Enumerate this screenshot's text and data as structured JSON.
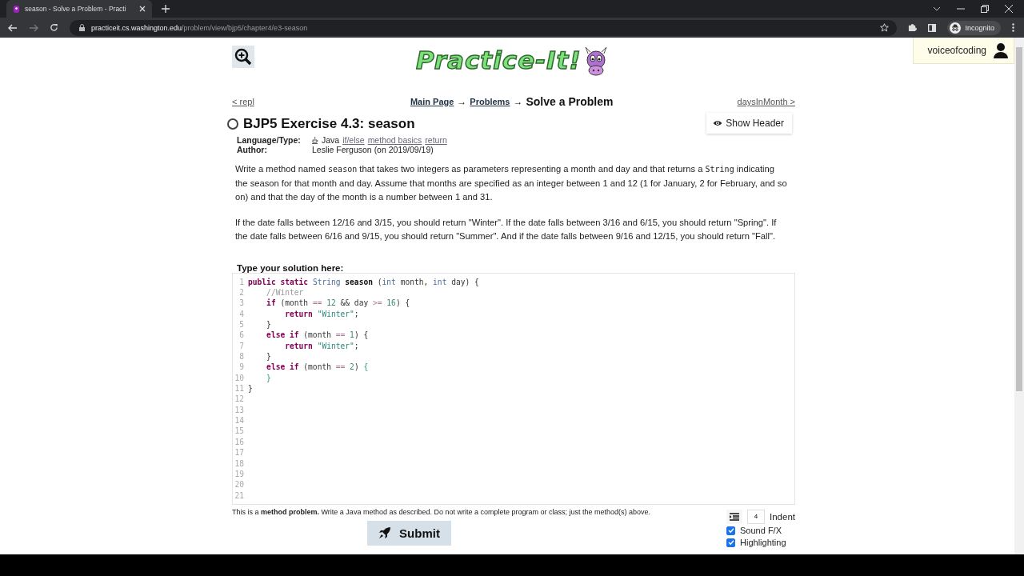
{
  "browser": {
    "tab_title": "season - Solve a Problem - Practi",
    "url_host": "practiceit.cs.washington.edu",
    "url_path": "/problem/view/bjp5/chapter4/e3-season",
    "profile": "Incognito"
  },
  "user": {
    "name": "voiceofcoding"
  },
  "logo": {
    "text": "Practice-It!"
  },
  "nav": {
    "prev": "< repl",
    "crumbs": [
      "Main Page",
      "Problems"
    ],
    "separators": [
      "→",
      "→"
    ],
    "current": "Solve a Problem",
    "next": "daysInMonth >"
  },
  "show_header_button": "Show Header",
  "problem": {
    "title": "BJP5 Exercise 4.3: season",
    "solved": false,
    "meta": [
      {
        "label": "Language/Type:",
        "kind": "type",
        "lang": "Java",
        "tags": [
          "if/else",
          "method basics",
          "return"
        ]
      },
      {
        "label": "Author:",
        "kind": "text",
        "value": "Leslie Ferguson (on 2019/09/19)"
      }
    ],
    "paragraphs": [
      [
        {
          "kind": "text",
          "text": "Write a method named "
        },
        {
          "kind": "code",
          "text": "season"
        },
        {
          "kind": "text",
          "text": " that takes two integers as parameters representing a month and day and that returns a "
        },
        {
          "kind": "code",
          "text": "String"
        },
        {
          "kind": "text",
          "text": " indicating the season for that month and day. Assume that months are specified as an integer between 1 and 12 (1 for January, 2 for February, and so on) and that the day of the month is a number between 1 and 31."
        }
      ],
      [
        {
          "kind": "text",
          "text": "If the date falls between 12/16 and 3/15, you should return \"Winter\". If the date falls between 3/16 and 6/15, you should return \"Spring\". If the date falls between 6/16 and 9/15, you should return \"Summer\". And if the date falls between 9/16 and 12/15, you should return \"Fall\"."
        }
      ]
    ]
  },
  "editor": {
    "label": "Type your solution here:",
    "lines": [
      {
        "number": "1",
        "tokens": [
          {
            "kind": "kw",
            "text": "public static "
          },
          {
            "kind": "type",
            "text": "String "
          },
          {
            "kind": "name",
            "text": "season"
          },
          {
            "kind": "plain",
            "text": " ("
          },
          {
            "kind": "type",
            "text": "int"
          },
          {
            "kind": "plain",
            "text": " month, "
          },
          {
            "kind": "type",
            "text": "int"
          },
          {
            "kind": "plain",
            "text": " day) {"
          }
        ]
      },
      {
        "number": "2",
        "tokens": [
          {
            "kind": "comment",
            "text": "    //Winter"
          }
        ]
      },
      {
        "number": "3",
        "tokens": [
          {
            "kind": "kw",
            "text": "    if"
          },
          {
            "kind": "plain",
            "text": " (month "
          },
          {
            "kind": "op",
            "text": "=="
          },
          {
            "kind": "num",
            "text": " 12"
          },
          {
            "kind": "plain",
            "text": " && day "
          },
          {
            "kind": "op",
            "text": ">="
          },
          {
            "kind": "num",
            "text": " 16"
          },
          {
            "kind": "plain",
            "text": ") {"
          }
        ]
      },
      {
        "number": "4",
        "tokens": [
          {
            "kind": "kw",
            "text": "        return "
          },
          {
            "kind": "str",
            "text": "\"Winter\""
          },
          {
            "kind": "plain",
            "text": ";"
          }
        ]
      },
      {
        "number": "5",
        "tokens": [
          {
            "kind": "plain",
            "text": "    }"
          }
        ]
      },
      {
        "number": "6",
        "tokens": [
          {
            "kind": "kw",
            "text": "    else if"
          },
          {
            "kind": "plain",
            "text": " (month "
          },
          {
            "kind": "op",
            "text": "=="
          },
          {
            "kind": "num",
            "text": " 1"
          },
          {
            "kind": "plain",
            "text": ") {"
          }
        ]
      },
      {
        "number": "7",
        "tokens": [
          {
            "kind": "kw",
            "text": "        return "
          },
          {
            "kind": "str",
            "text": "\"Winter\""
          },
          {
            "kind": "plain",
            "text": ";"
          }
        ]
      },
      {
        "number": "8",
        "tokens": [
          {
            "kind": "plain",
            "text": "    }"
          }
        ]
      },
      {
        "number": "9",
        "tokens": [
          {
            "kind": "kw",
            "text": "    else if"
          },
          {
            "kind": "plain",
            "text": " (month "
          },
          {
            "kind": "op",
            "text": "=="
          },
          {
            "kind": "num",
            "text": " 2"
          },
          {
            "kind": "plain",
            "text": ") "
          },
          {
            "kind": "match",
            "text": "{"
          }
        ]
      },
      {
        "number": "10",
        "tokens": [
          {
            "kind": "match",
            "text": "    }"
          }
        ]
      },
      {
        "number": "11",
        "tokens": [
          {
            "kind": "plain",
            "text": "}"
          }
        ]
      },
      {
        "number": "12"
      },
      {
        "number": "13"
      },
      {
        "number": "14"
      },
      {
        "number": "15"
      },
      {
        "number": "16"
      },
      {
        "number": "17"
      },
      {
        "number": "18"
      },
      {
        "number": "19"
      },
      {
        "number": "20"
      },
      {
        "number": "21"
      }
    ]
  },
  "note": "This is a **method problem.** Write a Java method as described. Do not write a complete program or class; just the method(s) above.",
  "submit": "Submit",
  "indent": {
    "value": "4",
    "label": "Indent"
  },
  "options": [
    {
      "label": "Sound F/X",
      "checked": true
    },
    {
      "label": "Highlighting",
      "checked": true
    }
  ]
}
